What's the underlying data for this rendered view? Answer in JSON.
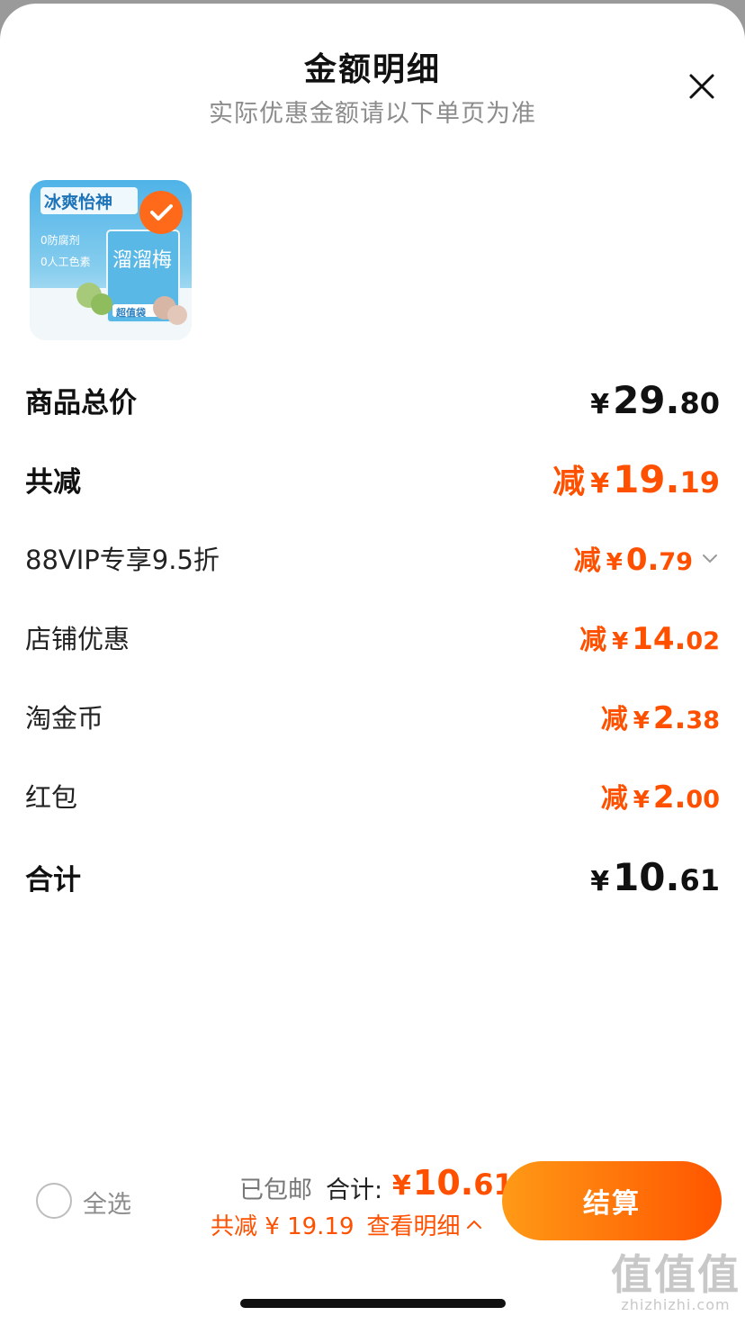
{
  "header": {
    "title": "金额明细",
    "subtitle": "实际优惠金额请以下单页为准"
  },
  "product": {
    "image_text_1": "冰爽怡神",
    "image_text_2": "溜溜梅",
    "image_text_3": "0防腐剂",
    "image_text_4": "0人工色素",
    "image_text_5": "超值袋",
    "selected": true
  },
  "rows": {
    "subtotal": {
      "label": "商品总价",
      "currency": "¥",
      "int": "29.",
      "dec": "80"
    },
    "discount_total": {
      "label": "共减",
      "prefix": "减",
      "currency": "¥",
      "int": "19.",
      "dec": "19"
    },
    "vip": {
      "label": "88VIP专享9.5折",
      "prefix": "减",
      "currency": "¥",
      "int": "0.",
      "dec": "79"
    },
    "store": {
      "label": "店铺优惠",
      "prefix": "减",
      "currency": "¥",
      "int": "14.",
      "dec": "02"
    },
    "coins": {
      "label": "淘金币",
      "prefix": "减",
      "currency": "¥",
      "int": "2.",
      "dec": "38"
    },
    "redpacket": {
      "label": "红包",
      "prefix": "减",
      "currency": "¥",
      "int": "2.",
      "dec": "00"
    },
    "total": {
      "label": "合计",
      "currency": "¥",
      "int": "10.",
      "dec": "61"
    }
  },
  "bottom_bar": {
    "select_all": "全选",
    "shipping": "已包邮",
    "total_label": "合计:",
    "total_currency": "¥",
    "total_int": "10.",
    "total_dec": "61",
    "saving_text": "共减 ¥ 19.19",
    "detail_link": "查看明细",
    "checkout": "结算"
  },
  "watermark": {
    "logo": "值值值",
    "site": "zhizhizhi.com"
  },
  "colors": {
    "accent": "#ff5000",
    "button_start": "#ff9a16",
    "button_end": "#ff5500"
  }
}
